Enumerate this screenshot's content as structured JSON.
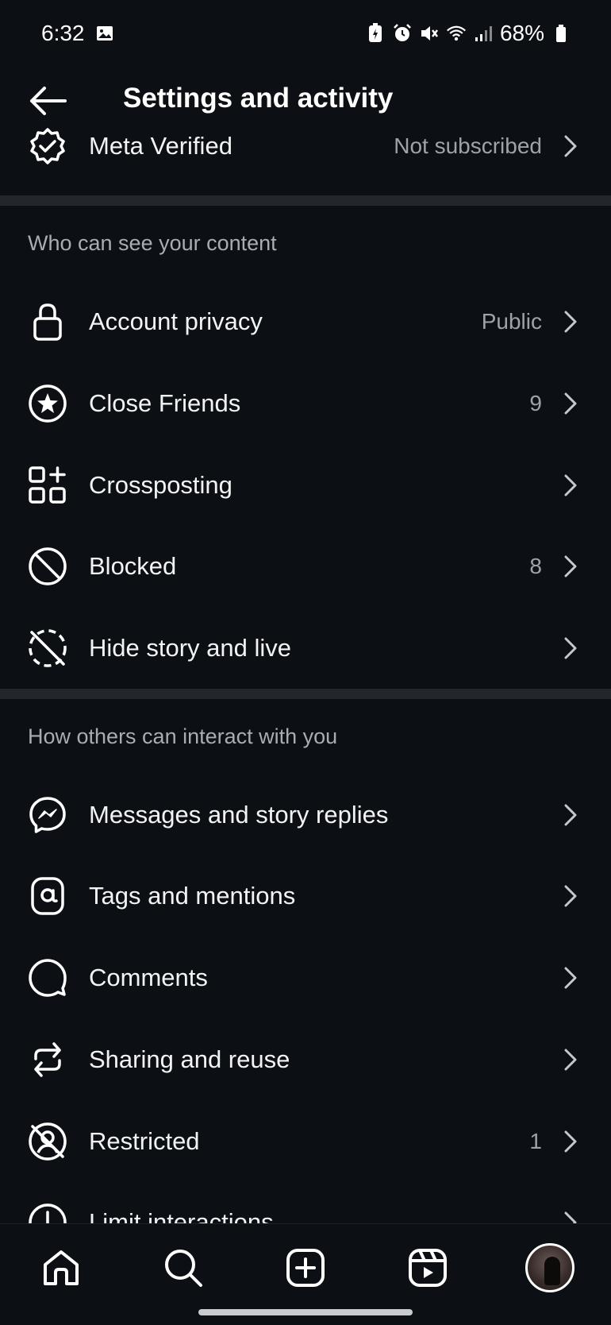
{
  "status_bar": {
    "time": "6:32",
    "battery": "68%",
    "icons": [
      "gallery-icon",
      "battery-saver-icon",
      "alarm-icon",
      "mute-icon",
      "wifi-icon",
      "signal-icon",
      "battery-icon"
    ]
  },
  "header": {
    "title": "Settings and activity",
    "back_icon": "arrow-left-icon"
  },
  "meta_verified": {
    "label": "Meta Verified",
    "value": "Not subscribed",
    "icon": "verified-badge-icon"
  },
  "section_content": {
    "title": "Who can see your content",
    "items": [
      {
        "label": "Account privacy",
        "value": "Public",
        "icon": "lock-icon"
      },
      {
        "label": "Close Friends",
        "value": "9",
        "icon": "star-circle-icon"
      },
      {
        "label": "Crossposting",
        "value": "",
        "icon": "grid-plus-icon"
      },
      {
        "label": "Blocked",
        "value": "8",
        "icon": "blocked-icon"
      },
      {
        "label": "Hide story and live",
        "value": "",
        "icon": "story-hidden-icon"
      }
    ]
  },
  "section_interact": {
    "title": "How others can interact with you",
    "items": [
      {
        "label": "Messages and story replies",
        "value": "",
        "icon": "messenger-icon"
      },
      {
        "label": "Tags and mentions",
        "value": "",
        "icon": "at-sign-icon"
      },
      {
        "label": "Comments",
        "value": "",
        "icon": "comment-icon"
      },
      {
        "label": "Sharing and reuse",
        "value": "",
        "icon": "share-reuse-icon"
      },
      {
        "label": "Restricted",
        "value": "1",
        "icon": "restricted-icon"
      },
      {
        "label": "Limit interactions",
        "value": "",
        "icon": "limit-icon"
      }
    ]
  },
  "bottom_nav": {
    "items": [
      "home-icon",
      "search-icon",
      "create-icon",
      "reels-icon",
      "profile-avatar"
    ]
  },
  "colors": {
    "background": "#0c0f14",
    "divider": "#23262c",
    "text_primary": "#f2f3f5",
    "text_secondary": "#9ea3ab"
  }
}
